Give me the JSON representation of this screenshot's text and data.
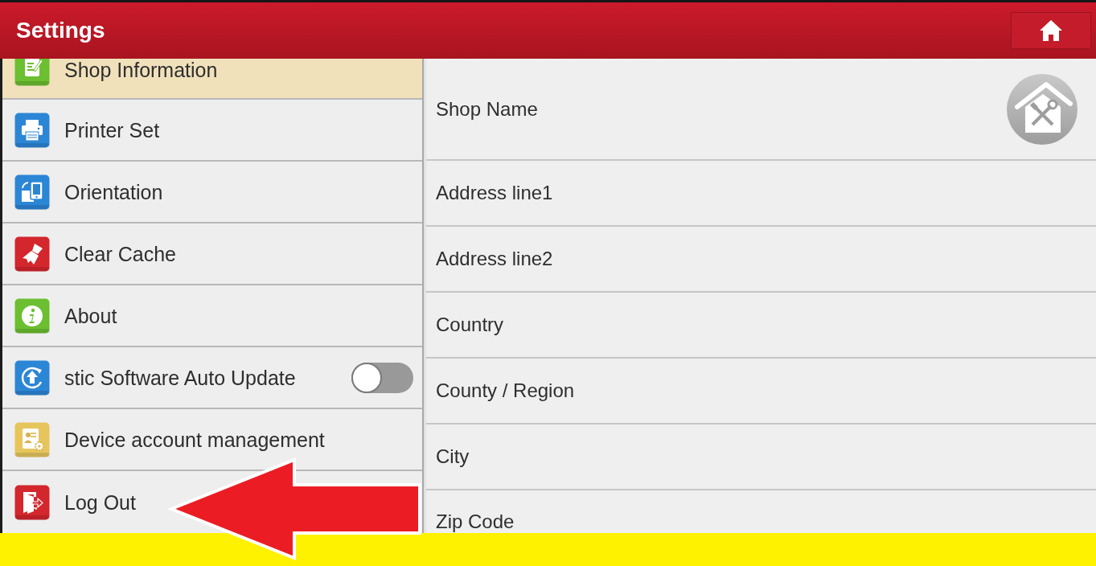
{
  "window": {
    "title": "Settings"
  },
  "sidebar": {
    "items": [
      {
        "label": "Shop Information",
        "kind": "link",
        "selected": true
      },
      {
        "label": "Printer Set",
        "kind": "link",
        "selected": false
      },
      {
        "label": "Orientation",
        "kind": "link",
        "selected": false
      },
      {
        "label": "Clear Cache",
        "kind": "link",
        "selected": false
      },
      {
        "label": "About",
        "kind": "link",
        "selected": false
      },
      {
        "label": "stic Software Auto Update",
        "kind": "toggle",
        "selected": false,
        "on": false
      },
      {
        "label": "Device account management",
        "kind": "link",
        "selected": false
      },
      {
        "label": "Log Out",
        "kind": "link",
        "selected": false
      }
    ]
  },
  "form": {
    "fields": [
      {
        "label": "Shop Name"
      },
      {
        "label": "Address line1"
      },
      {
        "label": "Address line2"
      },
      {
        "label": "Country"
      },
      {
        "label": "County / Region"
      },
      {
        "label": "City"
      },
      {
        "label": "Zip Code"
      }
    ]
  }
}
